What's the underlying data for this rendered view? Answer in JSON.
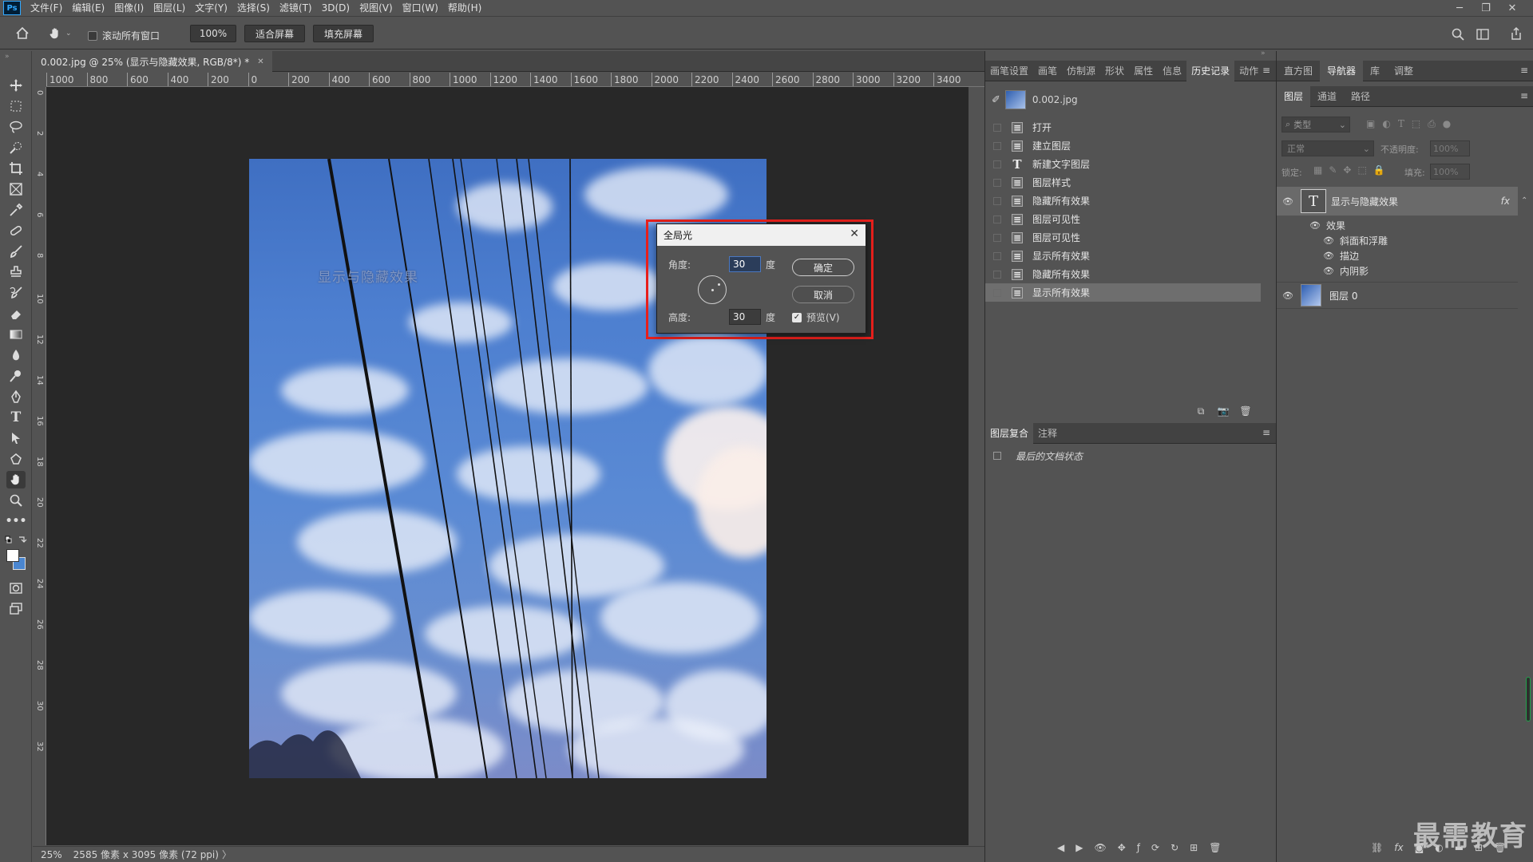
{
  "app": {
    "logo": "Ps"
  },
  "menu": [
    "文件(F)",
    "编辑(E)",
    "图像(I)",
    "图层(L)",
    "文字(Y)",
    "选择(S)",
    "滤镜(T)",
    "3D(D)",
    "视图(V)",
    "窗口(W)",
    "帮助(H)"
  ],
  "options": {
    "scroll_all_label": "滚动所有窗口",
    "zoom": "100%",
    "fit_screen": "适合屏幕",
    "fill_screen": "填充屏幕"
  },
  "document": {
    "tab_title": "0.002.jpg @ 25% (显示与隐藏效果, RGB/8*) *",
    "canvas_text": "显示与隐藏效果"
  },
  "ruler_h": [
    "1000",
    "800",
    "600",
    "400",
    "200",
    "0",
    "200",
    "400",
    "600",
    "800",
    "1000",
    "1200",
    "1400",
    "1600",
    "1800",
    "2000",
    "2200",
    "2400",
    "2600",
    "2800",
    "3000",
    "3200",
    "3400"
  ],
  "ruler_v": [
    "0",
    "2",
    "4",
    "6",
    "8",
    "10",
    "12",
    "14",
    "16",
    "18",
    "20",
    "22",
    "24",
    "26",
    "28",
    "30",
    "32"
  ],
  "status": {
    "zoom": "25%",
    "info": "2585 像素 x 3095 像素 (72 ppi)"
  },
  "history_panel": {
    "tabs": [
      "画笔设置",
      "画笔",
      "仿制源",
      "形状",
      "属性",
      "信息",
      "历史记录",
      "动作"
    ],
    "active_tab": "历史记录",
    "snapshot": "0.002.jpg",
    "items": [
      "打开",
      "建立图层",
      "新建文字图层",
      "图层样式",
      "隐藏所有效果",
      "图层可见性",
      "图层可见性",
      "显示所有效果",
      "隐藏所有效果",
      "显示所有效果"
    ],
    "selected_index": 9
  },
  "comps_panel": {
    "tabs": [
      "图层复合",
      "注释"
    ],
    "item": "最后的文档状态"
  },
  "right_top_tabs": [
    "直方图",
    "导航器",
    "库",
    "调整"
  ],
  "layers_panel": {
    "tabs": [
      "图层",
      "通道",
      "路径"
    ],
    "filter_label": "类型",
    "blend_mode": "正常",
    "opacity_label": "不透明度:",
    "opacity_value": "100%",
    "lock_label": "锁定:",
    "fill_label": "填充:",
    "fill_value": "100%",
    "layers": [
      {
        "name": "显示与隐藏效果",
        "fx_label": "fx",
        "effects_label": "效果",
        "effects": [
          "斜面和浮雕",
          "描边",
          "内阴影"
        ]
      },
      {
        "name": "图层 0"
      }
    ]
  },
  "dialog": {
    "title": "全局光",
    "angle_label": "角度:",
    "angle_value": "30",
    "altitude_label": "高度:",
    "altitude_value": "30",
    "unit": "度",
    "ok": "确定",
    "cancel": "取消",
    "preview": "预览(V)"
  },
  "watermark": "最需教育",
  "colors": {
    "highlight": "#e8201c",
    "ui_bg": "#535353",
    "canvas_bg": "#282828"
  }
}
